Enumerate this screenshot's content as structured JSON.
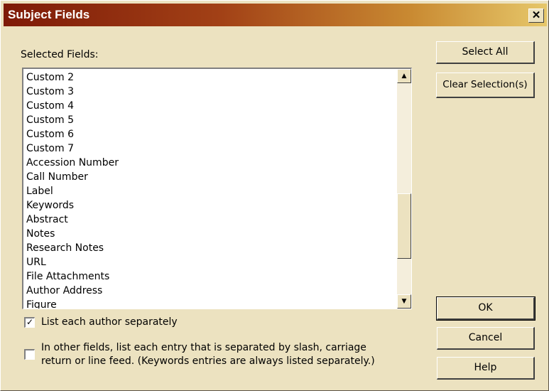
{
  "window": {
    "title": "Subject Fields",
    "close_label": "✕"
  },
  "selected_fields": {
    "label": "Selected Fields:",
    "items": [
      "Custom 2",
      "Custom 3",
      "Custom 4",
      "Custom 5",
      "Custom 6",
      "Custom 7",
      "Accession Number",
      "Call Number",
      "Label",
      "Keywords",
      "Abstract",
      "Notes",
      "Research Notes",
      "URL",
      "File Attachments",
      "Author Address",
      "Figure"
    ]
  },
  "scrollbar": {
    "up_glyph": "▲",
    "down_glyph": "▼",
    "position": 0.55
  },
  "buttons": {
    "select_all": "Select All",
    "clear_selection": "Clear Selection(s)",
    "ok": "OK",
    "cancel": "Cancel",
    "help": "Help"
  },
  "options": {
    "list_author": {
      "label": "List each author separately",
      "checked": true,
      "check_glyph": "✓"
    },
    "other_fields": {
      "line1": "In other fields, list each entry that is separated by slash, carriage",
      "line2": "return or line feed. (Keywords entries are always listed separately.)",
      "checked": false
    }
  }
}
